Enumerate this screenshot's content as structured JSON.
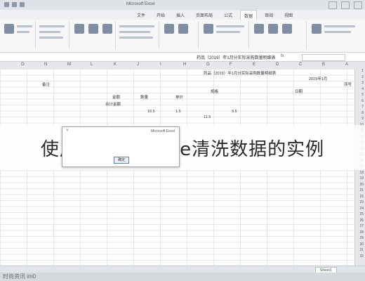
{
  "titlebar": {
    "title": "Microsoft Excel"
  },
  "tabs": [
    {
      "label": "文件"
    },
    {
      "label": "开始"
    },
    {
      "label": "插入"
    },
    {
      "label": "页面布局"
    },
    {
      "label": "公式"
    },
    {
      "label": "数据"
    },
    {
      "label": "审阅"
    },
    {
      "label": "视图"
    }
  ],
  "formula": {
    "fx": "fx",
    "content": "药品（2019）年1月分实际采购数量明细表"
  },
  "grid": {
    "columns": [
      "O",
      "N",
      "M",
      "L",
      "K",
      "J",
      "I",
      "H",
      "G",
      "F",
      "E",
      "D",
      "C",
      "B",
      "A"
    ],
    "rows": [
      "1",
      "2",
      "3",
      "4",
      "5",
      "6",
      "7",
      "8",
      "9",
      "10",
      "11",
      "12",
      "13",
      "14",
      "15",
      "16",
      "17",
      "18",
      "19",
      "20",
      "21",
      "22",
      "23",
      "24",
      "25",
      "26",
      "27",
      "28",
      "29",
      "30",
      "31",
      "32"
    ],
    "cells": [
      {
        "text": "药品（2019）年1月分实际采购数量明细表"
      },
      {
        "text": "2019年1月"
      },
      {
        "text": "序号"
      },
      {
        "text": "日期"
      },
      {
        "text": "规格"
      },
      {
        "text": "单价"
      },
      {
        "text": "数量"
      },
      {
        "text": "金额"
      },
      {
        "text": "备注"
      },
      {
        "text": "合计金额"
      },
      {
        "text": "1.5"
      },
      {
        "text": "10.5"
      },
      {
        "text": "9.5"
      },
      {
        "text": "11.5"
      }
    ]
  },
  "dialog": {
    "title": "Microsoft Excel",
    "close": "×",
    "ok_label": "确定"
  },
  "overlay": {
    "text": "使用OpenRefine清洗数据的实例"
  },
  "sheet": {
    "tab": "Sheet1"
  },
  "watermark": {
    "text": "时尚资讯 im0"
  }
}
